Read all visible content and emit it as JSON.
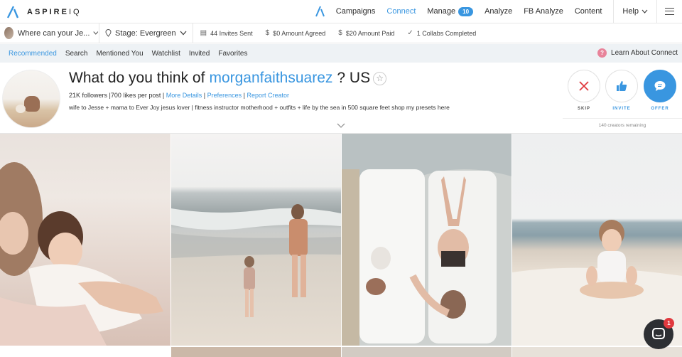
{
  "brand": {
    "logo_bold": "ASPIRE",
    "logo_thin": "IQ",
    "accent": "#3996e0"
  },
  "nav": {
    "items": [
      {
        "label": "Campaigns",
        "active": false
      },
      {
        "label": "Connect",
        "active": true
      },
      {
        "label": "Manage",
        "active": false,
        "badge": "10"
      },
      {
        "label": "Analyze",
        "active": false
      },
      {
        "label": "FB Analyze",
        "active": false
      },
      {
        "label": "Content",
        "active": false
      }
    ],
    "help": "Help"
  },
  "filterbar": {
    "project": "Where can your Je...",
    "stage": "Stage: Evergreen",
    "stats": [
      {
        "icon": "document-icon",
        "text": "44 Invites Sent"
      },
      {
        "icon": "dollar-icon",
        "text": "$0 Amount Agreed"
      },
      {
        "icon": "dollar-icon",
        "text": "$20 Amount Paid"
      },
      {
        "icon": "check-icon",
        "text": "1 Collabs Completed"
      }
    ]
  },
  "tabs": {
    "items": [
      "Recommended",
      "Search",
      "Mentioned You",
      "Watchlist",
      "Invited",
      "Favorites"
    ],
    "active": "Recommended",
    "learn": "Learn About Connect"
  },
  "profile": {
    "title_prefix": "What do you think of",
    "handle": "morganfaithsuarez",
    "country": "? US",
    "followers": "21K followers",
    "likes": "700 likes per post",
    "links": [
      "More Details",
      "Preferences",
      "Report Creator"
    ],
    "bio": "wife to Jesse + mama to Ever Joy jesus lover | fitness instructor motherhood + outfits + life by the sea in 500 square feet shop my presets here"
  },
  "actions": {
    "skip": "SKIP",
    "invite": "INVITE",
    "offer": "OFFER",
    "remaining": "140 creators remaining"
  },
  "chat": {
    "badge": "1"
  }
}
